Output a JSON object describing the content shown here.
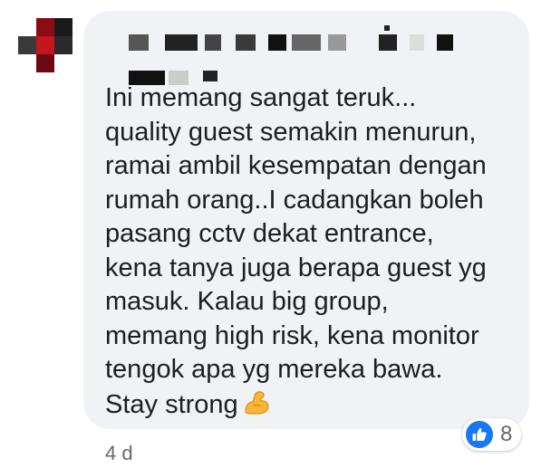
{
  "comment": {
    "text_lines": [
      "Ini memang sangat teruk...",
      "quality guest semakin menurun,",
      "ramai ambil kesempatan dengan",
      "rumah orang..I cadangkan boleh",
      "pasang cctv dekat entrance,",
      "kena tanya juga berapa guest yg",
      "masuk. Kalau big group,",
      "memang high risk, kena monitor",
      "tengok apa yg mereka bawa."
    ],
    "last_line": "Stay strong",
    "emoji_icon": "flexed-biceps-icon",
    "timestamp": "4 d",
    "reaction_icon": "like-icon",
    "reaction_count": "8"
  },
  "colors": {
    "bubble": "#f0f2f5",
    "text": "#1c1e21",
    "meta": "#65676b",
    "like": "#1877f2"
  }
}
